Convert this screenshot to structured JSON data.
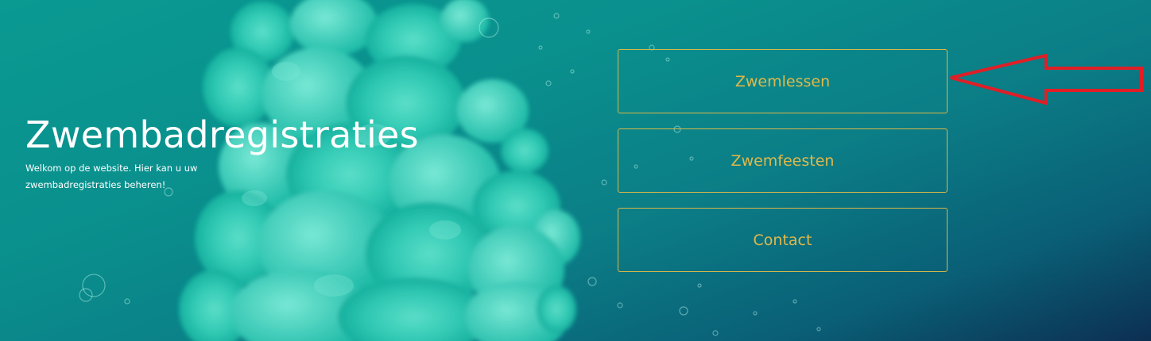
{
  "hero": {
    "title": "Zwembadregistraties",
    "subtitle": "Welkom op de website. Hier kan u uw zwembadregistraties beheren!"
  },
  "nav": {
    "buttons": [
      {
        "label": "Zwemlessen"
      },
      {
        "label": "Zwemfeesten"
      },
      {
        "label": "Contact"
      }
    ]
  },
  "colors": {
    "background_teal": "#0a9a92",
    "background_dark": "#0c2f52",
    "button_gold": "#e0b84a",
    "arrow_red": "#e01e26"
  },
  "annotations": {
    "arrow_icon": "red-arrow-left-icon"
  }
}
